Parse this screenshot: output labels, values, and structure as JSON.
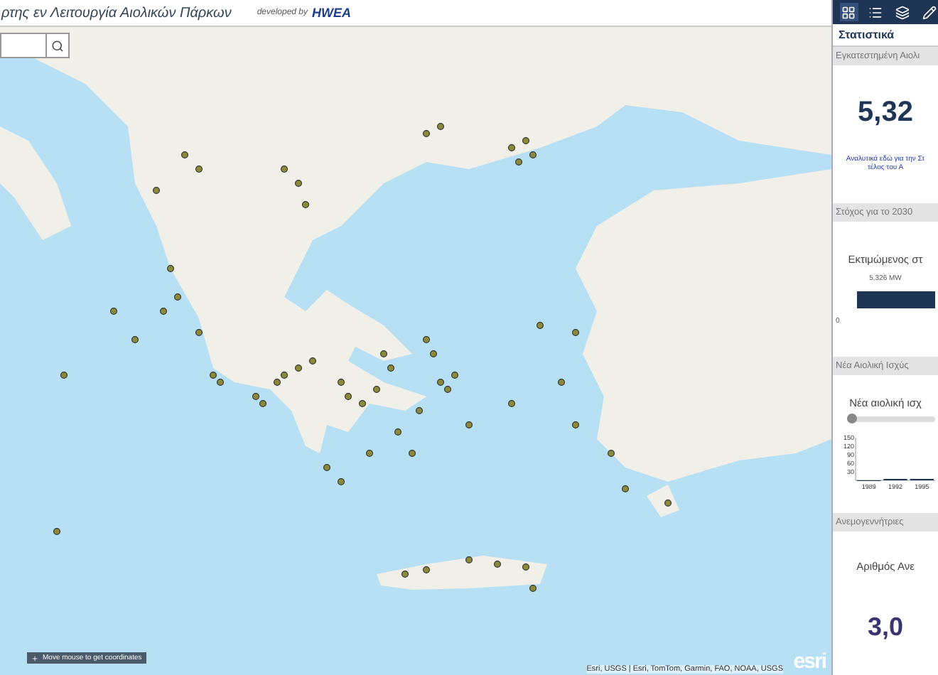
{
  "header": {
    "title": "ρτης εν Λειτουργία Αιολικών Πάρκων",
    "credit_prefix": "developed by",
    "credit_brand": "HWEA"
  },
  "map": {
    "coordinates_hint": "Move mouse to get coordinates",
    "attribution": "Esri, USGS | Esri, TomTom, Garmin, FAO, NOAA, USGS",
    "logo": "esri"
  },
  "panel": {
    "toolbar": [
      {
        "kind": "grid",
        "selected": true
      },
      {
        "kind": "list",
        "selected": false
      },
      {
        "kind": "layers",
        "selected": false
      },
      {
        "kind": "pencil",
        "selected": false
      }
    ],
    "title": "Στατιστικά",
    "sections": [
      {
        "kind": "number",
        "heading": "Εγκατεστημένη Αιολι",
        "value": "5,32",
        "note_lines": [
          "Αναλυτικά εδώ για την Στ",
          "τέλος του Α"
        ]
      },
      {
        "kind": "progress",
        "heading": "Στόχος για το 2030",
        "caption": "Εκτιμώμενος στ",
        "bar_label": "5,326 MW",
        "level": 1,
        "axis_min": "0"
      },
      {
        "kind": "chart",
        "heading": "Νέα Αιολική Ισχύς",
        "caption": "Νέα αιολική ισχ",
        "slider": {
          "level": 0
        },
        "chart_data": {
          "type": "bar",
          "categories": [
            "1989",
            "1992",
            "1995"
          ],
          "values": [
            0,
            5,
            5
          ],
          "ylim": [
            0,
            150
          ],
          "yticks": [
            30,
            60,
            90,
            120,
            150
          ]
        }
      },
      {
        "kind": "count",
        "heading": "Ανεμογεννήτριες",
        "caption": "Αριθμός Ανε",
        "value": "3,0"
      }
    ]
  }
}
